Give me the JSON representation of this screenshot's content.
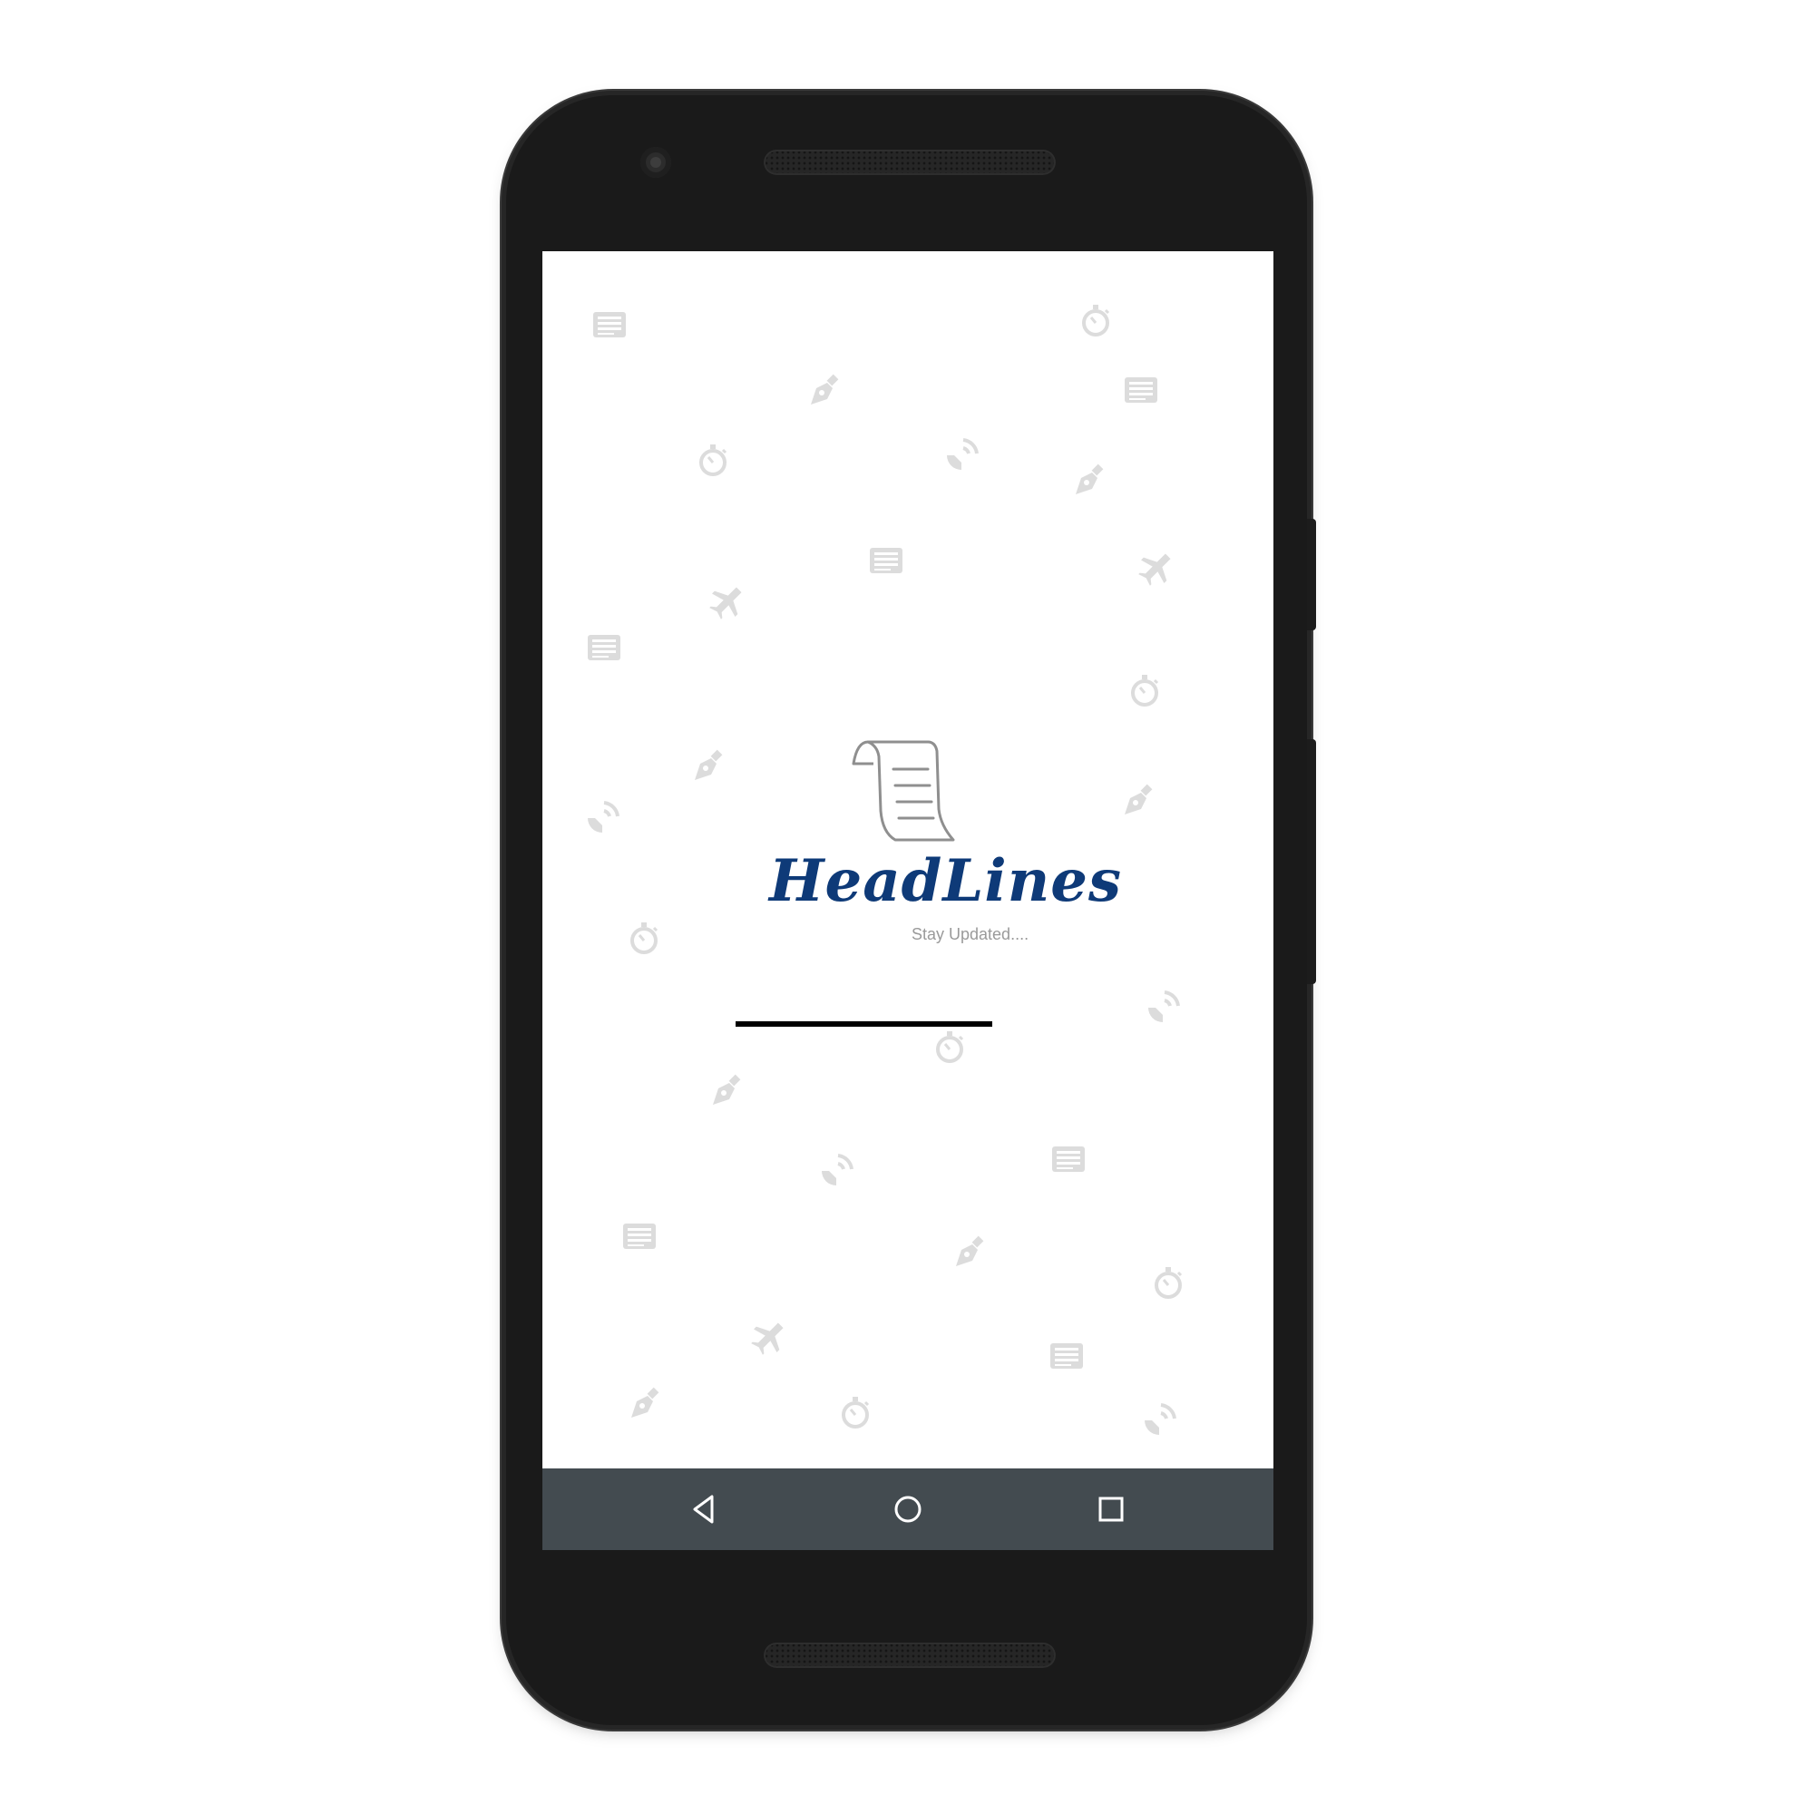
{
  "app": {
    "title": "HeadLines",
    "tagline": "Stay Updated....",
    "loading_progress": 1.0
  },
  "colors": {
    "title": "#0e3a78",
    "tagline": "#9a9a9a",
    "background_icons": "#dcdcdc",
    "nav_bar": "#434b50",
    "device_body": "#1a1a1a"
  },
  "background_pattern": {
    "icon_types": [
      "newspaper-icon",
      "stopwatch-icon",
      "pen-nib-icon",
      "satellite-dish-icon",
      "airplane-icon"
    ]
  },
  "navigation": {
    "buttons": [
      "back-button",
      "home-button",
      "recents-button"
    ]
  }
}
